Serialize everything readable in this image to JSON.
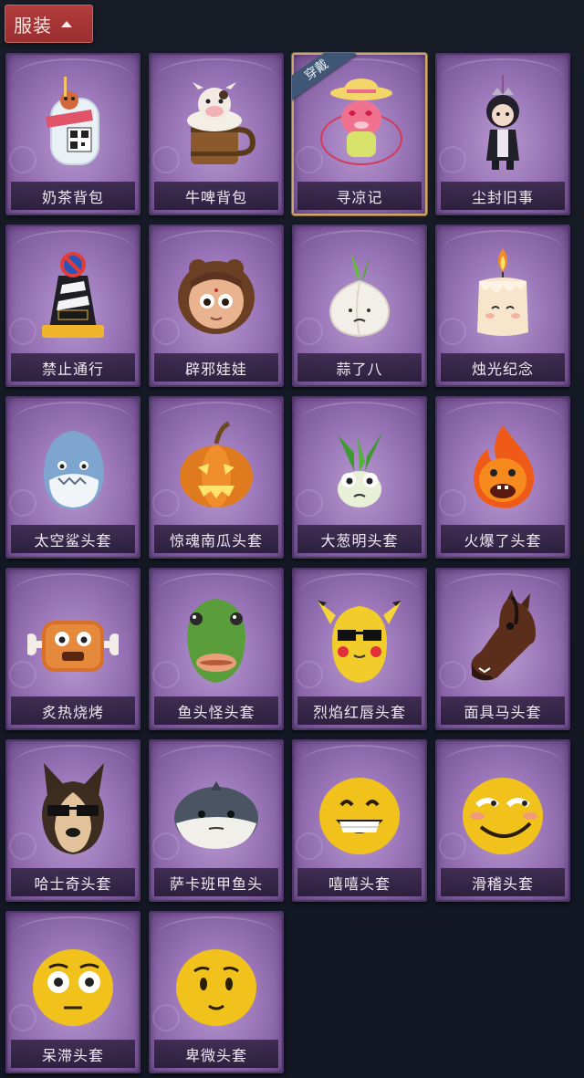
{
  "header": {
    "title": "服装"
  },
  "equipped_badge": "穿戴",
  "items": [
    {
      "label": "奶茶背包",
      "icon": "milk-tea-backpack-icon",
      "equipped": false
    },
    {
      "label": "牛啤背包",
      "icon": "cow-beer-backpack-icon",
      "equipped": false
    },
    {
      "label": "寻凉记",
      "icon": "pink-hat-creature-icon",
      "equipped": true
    },
    {
      "label": "尘封旧事",
      "icon": "chibi-character-icon",
      "equipped": false
    },
    {
      "label": "禁止通行",
      "icon": "no-entry-cone-icon",
      "equipped": false
    },
    {
      "label": "辟邪娃娃",
      "icon": "doll-head-icon",
      "equipped": false
    },
    {
      "label": "蒜了八",
      "icon": "garlic-icon",
      "equipped": false
    },
    {
      "label": "烛光纪念",
      "icon": "candle-icon",
      "equipped": false
    },
    {
      "label": "太空鲨头套",
      "icon": "shark-head-icon",
      "equipped": false
    },
    {
      "label": "惊魂南瓜头套",
      "icon": "pumpkin-head-icon",
      "equipped": false
    },
    {
      "label": "大葱明头套",
      "icon": "scallion-head-icon",
      "equipped": false
    },
    {
      "label": "火爆了头套",
      "icon": "fire-head-icon",
      "equipped": false
    },
    {
      "label": "炙热烧烤",
      "icon": "bbq-meat-icon",
      "equipped": false
    },
    {
      "label": "鱼头怪头套",
      "icon": "fish-head-icon",
      "equipped": false
    },
    {
      "label": "烈焰红唇头套",
      "icon": "sunglasses-pikachu-icon",
      "equipped": false
    },
    {
      "label": "面具马头套",
      "icon": "horse-head-icon",
      "equipped": false
    },
    {
      "label": "哈士奇头套",
      "icon": "husky-head-icon",
      "equipped": false
    },
    {
      "label": "萨卡班甲鱼头",
      "icon": "sacabambaspis-icon",
      "equipped": false
    },
    {
      "label": "嘻嘻头套",
      "icon": "grin-emoji-icon",
      "equipped": false
    },
    {
      "label": "滑稽头套",
      "icon": "funny-emoji-icon",
      "equipped": false
    },
    {
      "label": "呆滞头套",
      "icon": "dazed-emoji-icon",
      "equipped": false
    },
    {
      "label": "卑微头套",
      "icon": "humble-emoji-icon",
      "equipped": false
    }
  ]
}
